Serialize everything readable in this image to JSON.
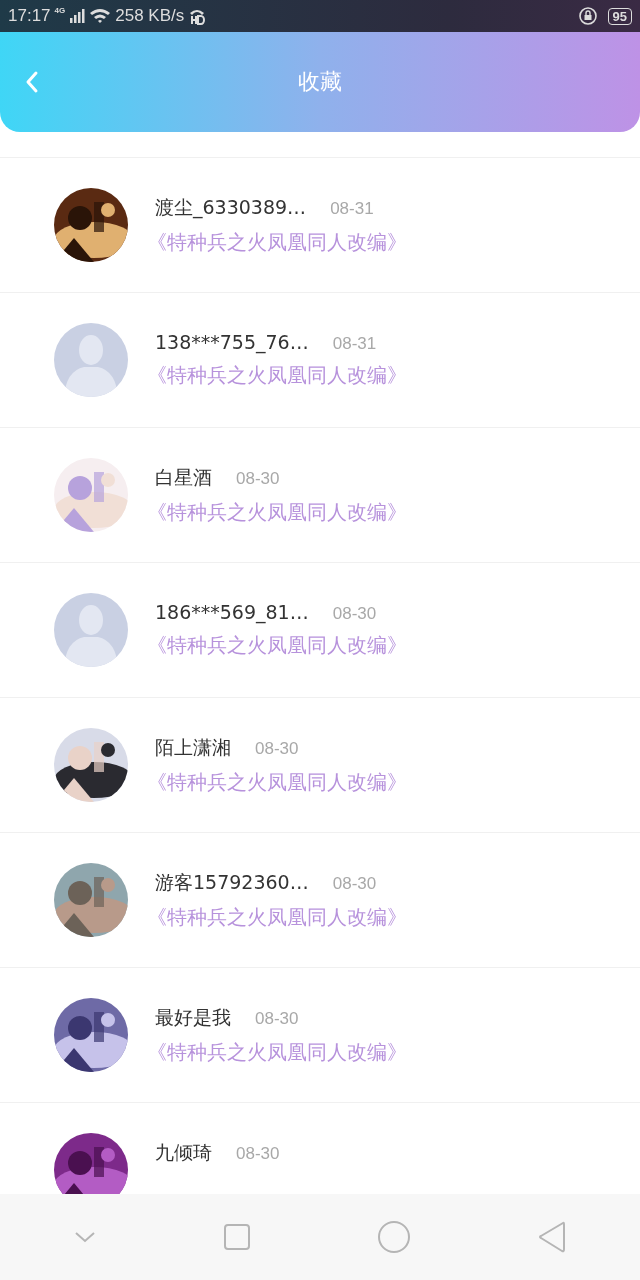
{
  "status_bar": {
    "time": "17:17",
    "network": "4G",
    "speed": "258 KB/s",
    "battery": "95"
  },
  "header": {
    "title": "收藏"
  },
  "items": [
    {
      "name": "渡尘_6330389…",
      "date": "08-31",
      "title": "《特种兵之火凤凰同人改编》",
      "kind": "picture"
    },
    {
      "name": "138***755_76…",
      "date": "08-31",
      "title": "《特种兵之火凤凰同人改编》",
      "kind": "default"
    },
    {
      "name": "白星酒",
      "date": "08-30",
      "title": "《特种兵之火凤凰同人改编》",
      "kind": "picture"
    },
    {
      "name": "186***569_81…",
      "date": "08-30",
      "title": "《特种兵之火凤凰同人改编》",
      "kind": "default"
    },
    {
      "name": "陌上潇湘",
      "date": "08-30",
      "title": "《特种兵之火凤凰同人改编》",
      "kind": "picture"
    },
    {
      "name": "游客15792360…",
      "date": "08-30",
      "title": "《特种兵之火凤凰同人改编》",
      "kind": "picture"
    },
    {
      "name": "最好是我",
      "date": "08-30",
      "title": "《特种兵之火凤凰同人改编》",
      "kind": "picture"
    },
    {
      "name": "九倾琦",
      "date": "08-30",
      "kind": "picture"
    }
  ]
}
